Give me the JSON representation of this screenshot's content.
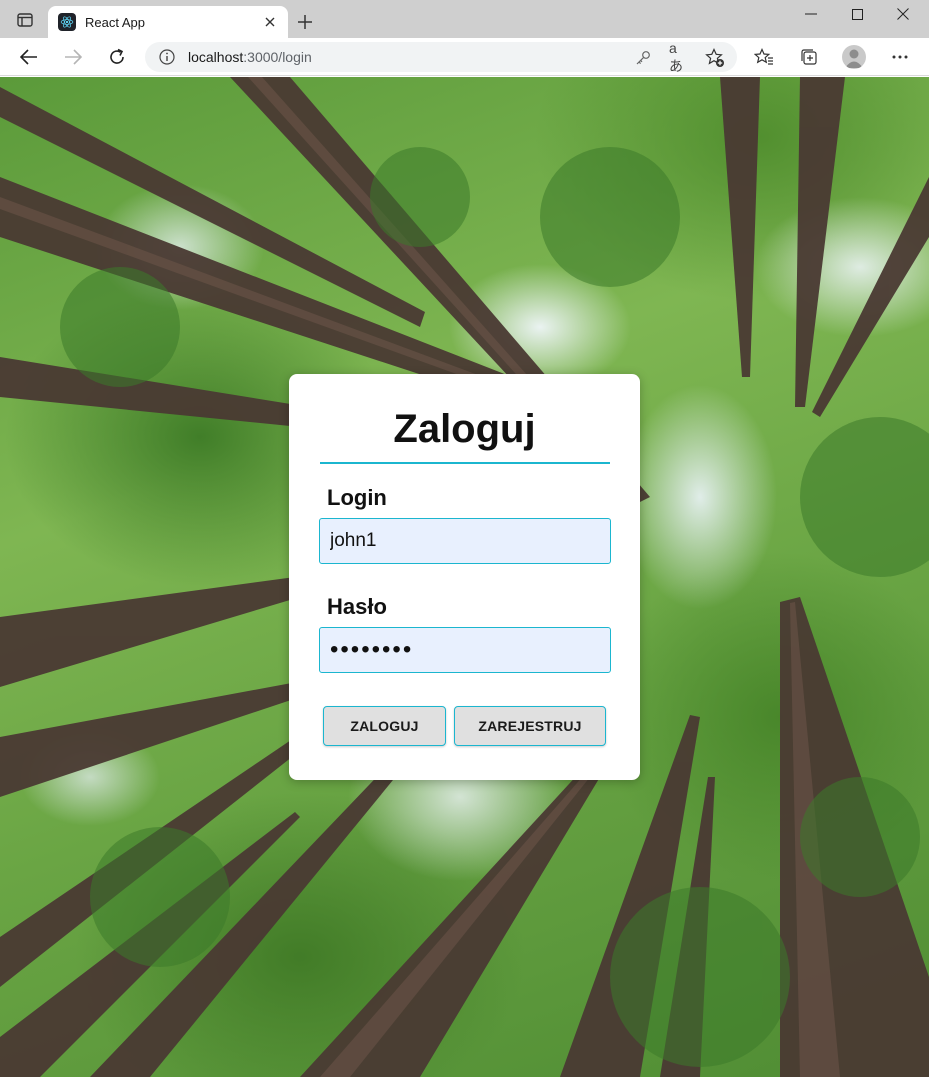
{
  "browser": {
    "tab": {
      "title": "React App",
      "favicon": "react-logo-icon"
    },
    "address": {
      "host": "localhost",
      "path": ":3000/login"
    },
    "icons": {
      "tab_actions": "tab-actions-icon",
      "close_tab": "close-icon",
      "new_tab": "plus-icon",
      "minimize": "minimize-icon",
      "maximize": "maximize-icon",
      "close_window": "close-icon",
      "back": "arrow-left-icon",
      "forward": "arrow-right-icon",
      "refresh": "refresh-icon",
      "site_info": "info-icon",
      "key": "key-icon",
      "read_aloud": "translate-icon",
      "add_favorite": "star-plus-icon",
      "favorites": "favorites-icon",
      "collections": "collections-icon",
      "profile": "profile-avatar",
      "menu": "more-icon"
    }
  },
  "login_card": {
    "title": "Zaloguj",
    "login": {
      "label": "Login",
      "value": "john1"
    },
    "password": {
      "label": "Hasło",
      "value": "12345678"
    },
    "buttons": {
      "login": "ZALOGUJ",
      "register": "ZAREJESTRUJ"
    }
  },
  "colors": {
    "accent": "#1bb6cf",
    "input_background": "#e8f0fe",
    "button_background": "#e0e0e0",
    "card_background": "#ffffff"
  },
  "background": {
    "description_icon": "forest-canopy-image"
  }
}
